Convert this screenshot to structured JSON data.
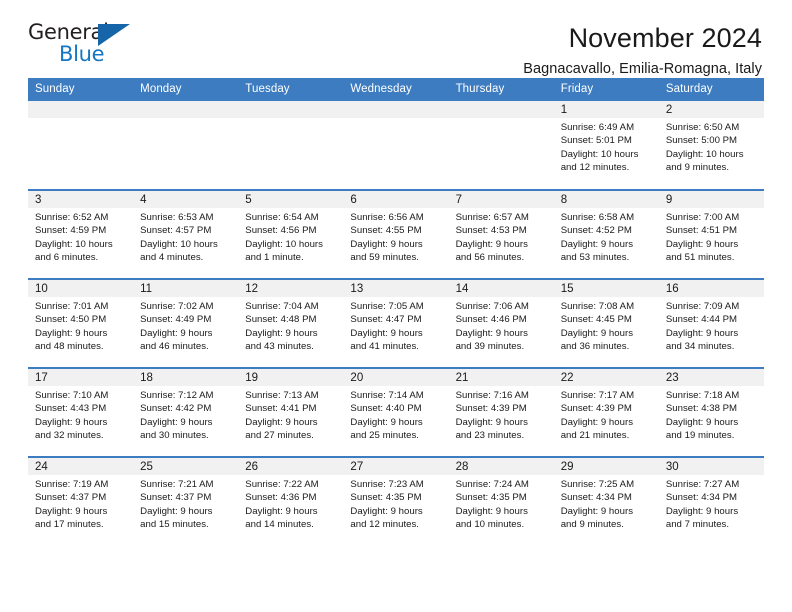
{
  "logo": {
    "word_one": "General",
    "word_two": "Blue",
    "triangle_color": "#1565a8",
    "blue_color": "#1477c4"
  },
  "header": {
    "title": "November 2024",
    "subtitle": "Bagnacavallo, Emilia-Romagna, Italy"
  },
  "theme": {
    "header_blue": "#3d7cc0",
    "daynum_band": "#f1f1f1",
    "text": "#1a1a1a"
  },
  "weekday_headers": [
    "Sunday",
    "Monday",
    "Tuesday",
    "Wednesday",
    "Thursday",
    "Friday",
    "Saturday"
  ],
  "weeks": [
    [
      {
        "day": "",
        "empty": true
      },
      {
        "day": "",
        "empty": true
      },
      {
        "day": "",
        "empty": true
      },
      {
        "day": "",
        "empty": true
      },
      {
        "day": "",
        "empty": true
      },
      {
        "day": "1",
        "sunrise": "Sunrise: 6:49 AM",
        "sunset": "Sunset: 5:01 PM",
        "daylight_line1": "Daylight: 10 hours",
        "daylight_line2": "and 12 minutes."
      },
      {
        "day": "2",
        "sunrise": "Sunrise: 6:50 AM",
        "sunset": "Sunset: 5:00 PM",
        "daylight_line1": "Daylight: 10 hours",
        "daylight_line2": "and 9 minutes."
      }
    ],
    [
      {
        "day": "3",
        "sunrise": "Sunrise: 6:52 AM",
        "sunset": "Sunset: 4:59 PM",
        "daylight_line1": "Daylight: 10 hours",
        "daylight_line2": "and 6 minutes."
      },
      {
        "day": "4",
        "sunrise": "Sunrise: 6:53 AM",
        "sunset": "Sunset: 4:57 PM",
        "daylight_line1": "Daylight: 10 hours",
        "daylight_line2": "and 4 minutes."
      },
      {
        "day": "5",
        "sunrise": "Sunrise: 6:54 AM",
        "sunset": "Sunset: 4:56 PM",
        "daylight_line1": "Daylight: 10 hours",
        "daylight_line2": "and 1 minute."
      },
      {
        "day": "6",
        "sunrise": "Sunrise: 6:56 AM",
        "sunset": "Sunset: 4:55 PM",
        "daylight_line1": "Daylight: 9 hours",
        "daylight_line2": "and 59 minutes."
      },
      {
        "day": "7",
        "sunrise": "Sunrise: 6:57 AM",
        "sunset": "Sunset: 4:53 PM",
        "daylight_line1": "Daylight: 9 hours",
        "daylight_line2": "and 56 minutes."
      },
      {
        "day": "8",
        "sunrise": "Sunrise: 6:58 AM",
        "sunset": "Sunset: 4:52 PM",
        "daylight_line1": "Daylight: 9 hours",
        "daylight_line2": "and 53 minutes."
      },
      {
        "day": "9",
        "sunrise": "Sunrise: 7:00 AM",
        "sunset": "Sunset: 4:51 PM",
        "daylight_line1": "Daylight: 9 hours",
        "daylight_line2": "and 51 minutes."
      }
    ],
    [
      {
        "day": "10",
        "sunrise": "Sunrise: 7:01 AM",
        "sunset": "Sunset: 4:50 PM",
        "daylight_line1": "Daylight: 9 hours",
        "daylight_line2": "and 48 minutes."
      },
      {
        "day": "11",
        "sunrise": "Sunrise: 7:02 AM",
        "sunset": "Sunset: 4:49 PM",
        "daylight_line1": "Daylight: 9 hours",
        "daylight_line2": "and 46 minutes."
      },
      {
        "day": "12",
        "sunrise": "Sunrise: 7:04 AM",
        "sunset": "Sunset: 4:48 PM",
        "daylight_line1": "Daylight: 9 hours",
        "daylight_line2": "and 43 minutes."
      },
      {
        "day": "13",
        "sunrise": "Sunrise: 7:05 AM",
        "sunset": "Sunset: 4:47 PM",
        "daylight_line1": "Daylight: 9 hours",
        "daylight_line2": "and 41 minutes."
      },
      {
        "day": "14",
        "sunrise": "Sunrise: 7:06 AM",
        "sunset": "Sunset: 4:46 PM",
        "daylight_line1": "Daylight: 9 hours",
        "daylight_line2": "and 39 minutes."
      },
      {
        "day": "15",
        "sunrise": "Sunrise: 7:08 AM",
        "sunset": "Sunset: 4:45 PM",
        "daylight_line1": "Daylight: 9 hours",
        "daylight_line2": "and 36 minutes."
      },
      {
        "day": "16",
        "sunrise": "Sunrise: 7:09 AM",
        "sunset": "Sunset: 4:44 PM",
        "daylight_line1": "Daylight: 9 hours",
        "daylight_line2": "and 34 minutes."
      }
    ],
    [
      {
        "day": "17",
        "sunrise": "Sunrise: 7:10 AM",
        "sunset": "Sunset: 4:43 PM",
        "daylight_line1": "Daylight: 9 hours",
        "daylight_line2": "and 32 minutes."
      },
      {
        "day": "18",
        "sunrise": "Sunrise: 7:12 AM",
        "sunset": "Sunset: 4:42 PM",
        "daylight_line1": "Daylight: 9 hours",
        "daylight_line2": "and 30 minutes."
      },
      {
        "day": "19",
        "sunrise": "Sunrise: 7:13 AM",
        "sunset": "Sunset: 4:41 PM",
        "daylight_line1": "Daylight: 9 hours",
        "daylight_line2": "and 27 minutes."
      },
      {
        "day": "20",
        "sunrise": "Sunrise: 7:14 AM",
        "sunset": "Sunset: 4:40 PM",
        "daylight_line1": "Daylight: 9 hours",
        "daylight_line2": "and 25 minutes."
      },
      {
        "day": "21",
        "sunrise": "Sunrise: 7:16 AM",
        "sunset": "Sunset: 4:39 PM",
        "daylight_line1": "Daylight: 9 hours",
        "daylight_line2": "and 23 minutes."
      },
      {
        "day": "22",
        "sunrise": "Sunrise: 7:17 AM",
        "sunset": "Sunset: 4:39 PM",
        "daylight_line1": "Daylight: 9 hours",
        "daylight_line2": "and 21 minutes."
      },
      {
        "day": "23",
        "sunrise": "Sunrise: 7:18 AM",
        "sunset": "Sunset: 4:38 PM",
        "daylight_line1": "Daylight: 9 hours",
        "daylight_line2": "and 19 minutes."
      }
    ],
    [
      {
        "day": "24",
        "sunrise": "Sunrise: 7:19 AM",
        "sunset": "Sunset: 4:37 PM",
        "daylight_line1": "Daylight: 9 hours",
        "daylight_line2": "and 17 minutes."
      },
      {
        "day": "25",
        "sunrise": "Sunrise: 7:21 AM",
        "sunset": "Sunset: 4:37 PM",
        "daylight_line1": "Daylight: 9 hours",
        "daylight_line2": "and 15 minutes."
      },
      {
        "day": "26",
        "sunrise": "Sunrise: 7:22 AM",
        "sunset": "Sunset: 4:36 PM",
        "daylight_line1": "Daylight: 9 hours",
        "daylight_line2": "and 14 minutes."
      },
      {
        "day": "27",
        "sunrise": "Sunrise: 7:23 AM",
        "sunset": "Sunset: 4:35 PM",
        "daylight_line1": "Daylight: 9 hours",
        "daylight_line2": "and 12 minutes."
      },
      {
        "day": "28",
        "sunrise": "Sunrise: 7:24 AM",
        "sunset": "Sunset: 4:35 PM",
        "daylight_line1": "Daylight: 9 hours",
        "daylight_line2": "and 10 minutes."
      },
      {
        "day": "29",
        "sunrise": "Sunrise: 7:25 AM",
        "sunset": "Sunset: 4:34 PM",
        "daylight_line1": "Daylight: 9 hours",
        "daylight_line2": "and 9 minutes."
      },
      {
        "day": "30",
        "sunrise": "Sunrise: 7:27 AM",
        "sunset": "Sunset: 4:34 PM",
        "daylight_line1": "Daylight: 9 hours",
        "daylight_line2": "and 7 minutes."
      }
    ]
  ]
}
